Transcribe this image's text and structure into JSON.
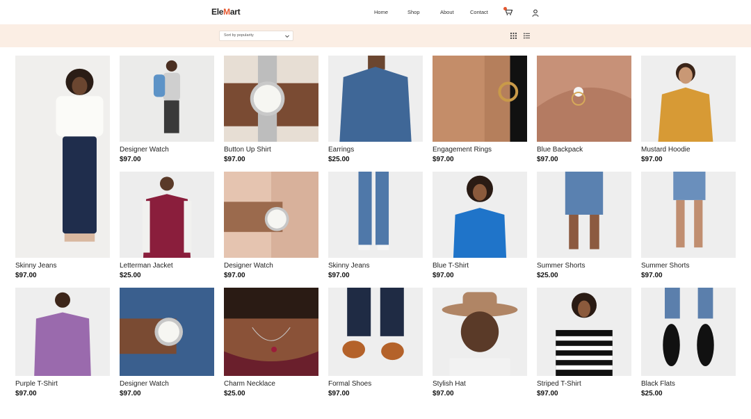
{
  "header": {
    "logo_prefix": "Ele",
    "logo_accent": "M",
    "logo_suffix": "art",
    "nav": [
      "Home",
      "Shop",
      "About",
      "Contact"
    ]
  },
  "filter": {
    "sort_label": "Sort by popularity"
  },
  "colors": {
    "accent": "#e4572e",
    "filter_bg": "#fbeee4"
  },
  "products": [
    {
      "name": "Skinny Jeans",
      "price": "$97.00"
    },
    {
      "name": "Designer Watch",
      "price": "$97.00"
    },
    {
      "name": "Button Up Shirt",
      "price": "$97.00"
    },
    {
      "name": "Earrings",
      "price": "$25.00"
    },
    {
      "name": "Engagement Rings",
      "price": "$97.00"
    },
    {
      "name": "Blue Backpack",
      "price": "$97.00"
    },
    {
      "name": "Mustard Hoodie",
      "price": "$97.00"
    },
    {
      "name": "Letterman Jacket",
      "price": "$25.00"
    },
    {
      "name": "Designer Watch",
      "price": "$97.00"
    },
    {
      "name": "Skinny Jeans",
      "price": "$97.00"
    },
    {
      "name": "Blue T-Shirt",
      "price": "$97.00"
    },
    {
      "name": "Summer Shorts",
      "price": "$25.00"
    },
    {
      "name": "Summer Shorts",
      "price": "$97.00"
    },
    {
      "name": "Purple T-Shirt",
      "price": "$97.00"
    },
    {
      "name": "Designer Watch",
      "price": "$97.00"
    },
    {
      "name": "Charm Necklace",
      "price": "$25.00"
    },
    {
      "name": "Formal Shoes",
      "price": "$97.00"
    },
    {
      "name": "Stylish Hat",
      "price": "$97.00"
    },
    {
      "name": "Striped T-Shirt",
      "price": "$97.00"
    },
    {
      "name": "Black Flats",
      "price": "$25.00"
    }
  ]
}
